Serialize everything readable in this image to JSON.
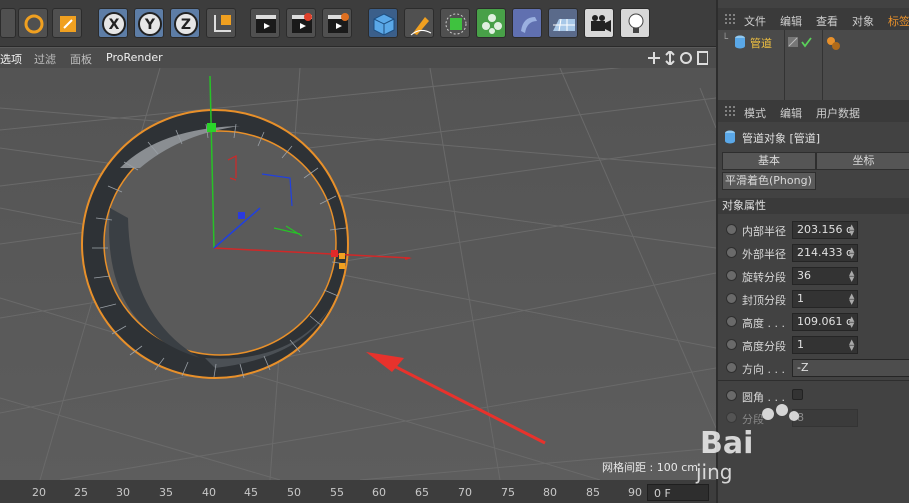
{
  "viewport_menu": {
    "items": [
      "选项",
      "过滤",
      "面板",
      "ProRender"
    ]
  },
  "toolbar": {
    "axis_x": "X",
    "axis_y": "Y",
    "axis_z": "Z"
  },
  "viewport": {
    "grid_spacing": "网格间距 : 100 cm",
    "nav_icons": [
      "move-view-icon",
      "zoom-view-icon",
      "rotate-view-icon",
      "maximize-view-icon"
    ]
  },
  "timeline": {
    "ticks": [
      "20",
      "25",
      "30",
      "35",
      "40",
      "45",
      "50",
      "55",
      "60",
      "65",
      "70",
      "75",
      "80",
      "85",
      "90"
    ],
    "current_frame": "0 F"
  },
  "object_manager": {
    "menu": [
      "文件",
      "编辑",
      "查看",
      "对象",
      "标签"
    ],
    "object_name": "管道"
  },
  "attribute_manager": {
    "menu": [
      "模式",
      "编辑",
      "用户数据"
    ],
    "title": "管道对象 [管道]",
    "tabs": [
      "基本",
      "坐标"
    ],
    "subtab": "平滑着色(Phong)",
    "section": "对象属性",
    "fields": [
      {
        "label": "内部半径",
        "value": "203.156 c"
      },
      {
        "label": "外部半径",
        "value": "214.433 c"
      },
      {
        "label": "旋转分段",
        "value": "36"
      },
      {
        "label": "封顶分段",
        "value": "1"
      },
      {
        "label": "高度 . . .",
        "value": "109.061 c"
      },
      {
        "label": "高度分段",
        "value": "1"
      },
      {
        "label": "方向 . . .",
        "value": "-Z"
      }
    ],
    "fillet_label": "圆角 . . .",
    "segments_label": "分段",
    "segments_value": "8"
  },
  "watermark": {
    "line1": "Bai",
    "line2": "jing"
  },
  "colors": {
    "accent_orange": "#e8902a",
    "arrow_red": "#e8322c",
    "x_axis": "#d02828",
    "y_axis": "#27c227",
    "z_axis": "#2040e0"
  }
}
